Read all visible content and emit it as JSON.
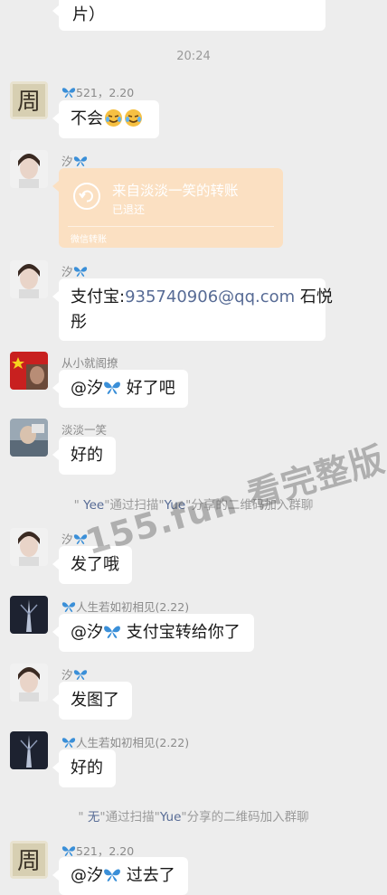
{
  "top_bubble": {
    "text": "片）"
  },
  "time_divider": "20:24",
  "messages": [
    {
      "name": "521，2.20",
      "text": "不会"
    },
    {
      "name": "汐",
      "transfer": {
        "title": "来自淡淡一笑的转账",
        "status": "已退还",
        "footer": "微信转账"
      }
    },
    {
      "name": "汐",
      "text_line1": "支付宝:",
      "email": "935740906@qq.com",
      "text_line1_tail": " 石悦",
      "text_line2": "彤"
    },
    {
      "name": "从小就阁撩",
      "mention": "@汐",
      "text": " 好了吧"
    },
    {
      "name": "淡淡一笑",
      "text": "好的"
    },
    {
      "name": "汐",
      "text": "发了哦"
    },
    {
      "name": "人生若如初相见(2.22)",
      "mention": "@汐",
      "text": " 支付宝转给你了"
    },
    {
      "name": "汐",
      "text": "发图了"
    },
    {
      "name": "人生若如初相见(2.22)",
      "text": "好的"
    },
    {
      "name": "521，2.20",
      "mention": "@汐",
      "text": " 过去了"
    }
  ],
  "system_messages": [
    {
      "q": "\"",
      "n": " Yee",
      "m": "\"通过扫描\"",
      "i": "Yue",
      "t": "\"分享的二维码加入群聊"
    },
    {
      "q": "\"",
      "n": " 无",
      "m": "\"通过扫描\"",
      "i": "Yue",
      "t": "\"分享的二维码加入群聊"
    }
  ],
  "watermark": "155.fun 看完整版",
  "colors": {
    "background": "#ededed",
    "bubble": "#ffffff",
    "transfer_card": "#fbe0c2",
    "link": "#576b95",
    "butterfly": "#3a8fd8"
  }
}
